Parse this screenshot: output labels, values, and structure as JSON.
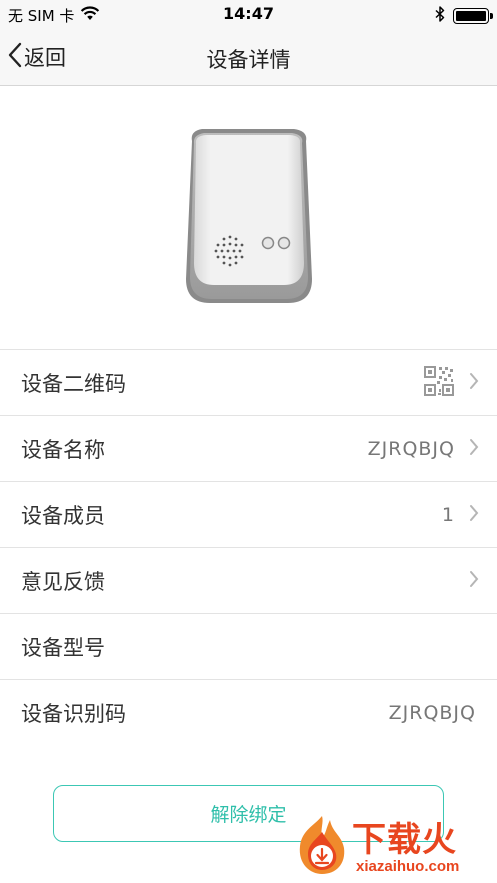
{
  "status_bar": {
    "carrier": "无 SIM 卡",
    "time": "14:47",
    "battery_level": 1.0
  },
  "nav": {
    "back_label": "返回",
    "title": "设备详情"
  },
  "list": {
    "rows": [
      {
        "label": "设备二维码",
        "value": "",
        "icon": "qr-code-icon",
        "chevron": true
      },
      {
        "label": "设备名称",
        "value": "ZJRQBJQ",
        "chevron": true
      },
      {
        "label": "设备成员",
        "value": "1",
        "chevron": true
      },
      {
        "label": "意见反馈",
        "value": "",
        "chevron": true
      },
      {
        "label": "设备型号",
        "value": "",
        "chevron": false
      },
      {
        "label": "设备识别码",
        "value": "ZJRQBJQ",
        "chevron": false
      }
    ]
  },
  "actions": {
    "unbind_label": "解除绑定"
  },
  "watermark": {
    "title": "下载火",
    "url": "xiazaihuo.com"
  },
  "colors": {
    "accent": "#3cc7b4",
    "watermark": "#e8461f",
    "nav_background": "#f7f7f7"
  }
}
